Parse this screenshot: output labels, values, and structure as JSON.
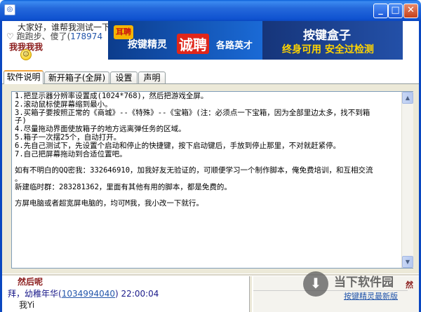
{
  "window": {
    "icon_glyph": "◎",
    "minimize_glyph": "_",
    "maximize_glyph": "□",
    "close_glyph": "✕"
  },
  "chat_top": {
    "line1": "大家好，谁帮我测试一下把",
    "line2_prefix": "♡  跑跑步、傻了(",
    "line2_link": "178974",
    "line3": "我我我我",
    "smiley_glyph": "☺"
  },
  "banner_left": {
    "logo": "耳聘",
    "text1": "按键精灵",
    "text2": "诚聘",
    "text3": "各路英才"
  },
  "banner_right": {
    "title": "按键盒子",
    "subtitle": "终身可用  安全过检测"
  },
  "tabs": [
    {
      "label": "软件说明"
    },
    {
      "label": "新开箱子(全屏)"
    },
    {
      "label": "设置"
    },
    {
      "label": "声明"
    }
  ],
  "textarea": {
    "content": "1.把显示器分辨率设置成(1024*768)，然后把游戏全屏。\n2.滚动鼠标使屏幕缩到最小。\n3.买箱子要按照正常的《商城》--《特殊》--《宝箱》(注：必须点一下宝箱，因为全部里边太多，找不到箱\n子)\n4.尽量拖动界面使放箱子的地方远离弹任务的区域。\n5.箱子一次摆25个，自动打开。\n6.先自己测试下，先设置个启动和停止的快捷键，按下启动键后，手放到停止那里，不对就赶紧停。\n7.自己把屏幕拖动到合适位置吧。\n\n如有不明白的QQ密我：332646910，加我好友无验证的，可顺便学习一个制作脚本，俺免费培训，和互相交流\n。\n新建临时群：283281362，里面有其他有用的脚本，都是免费的。\n\n方屏电脑或者超宽屏电脑的，均可M我，我小改一下就行。",
    "scroll_up": "▲",
    "scroll_down": "▼"
  },
  "chat_bottom": {
    "name": "然后呢",
    "meta_prefix": "拜，幼稚年华(",
    "meta_link": "1034994040",
    "meta_suffix": ")  22:00:04",
    "message": "我Yi"
  },
  "watermark": {
    "icon_glyph": "⬇",
    "text": "当下软件园",
    "url": "d",
    "link": "按键精灵最新版",
    "right_char": "然"
  }
}
